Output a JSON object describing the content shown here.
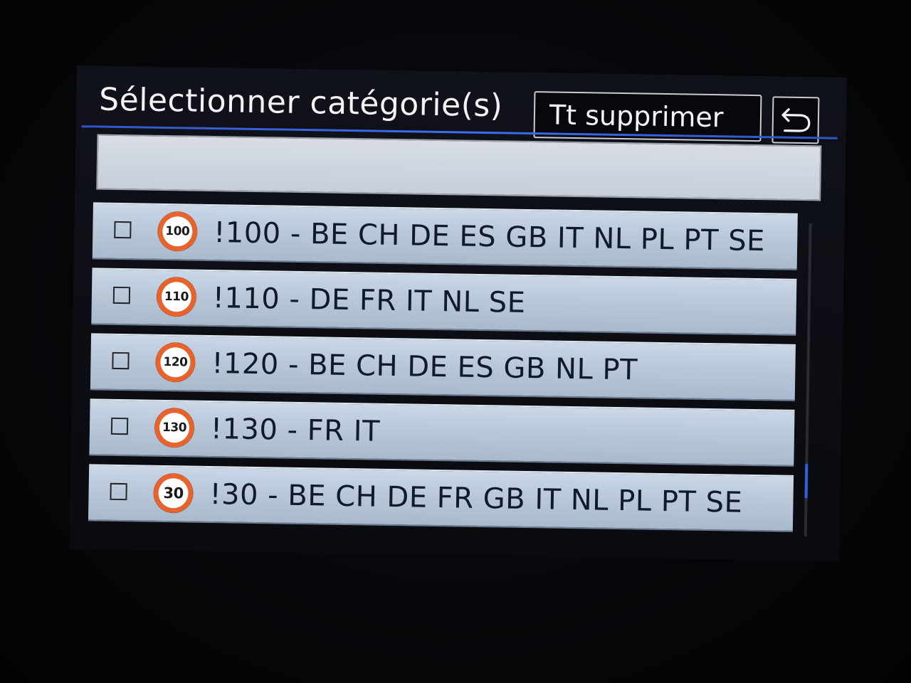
{
  "header": {
    "title": "Sélectionner catégorie(s)",
    "delete_all_label": "Tt supprimer",
    "back_icon": "return-arrow-icon"
  },
  "search": {
    "value": ""
  },
  "list": {
    "items": [
      {
        "sign": "100",
        "label": "!100 - BE CH DE ES GB IT NL PL PT SE",
        "checked": false
      },
      {
        "sign": "110",
        "label": "!110 - DE FR IT NL SE",
        "checked": false
      },
      {
        "sign": "120",
        "label": "!120 - BE CH DE ES GB NL PT",
        "checked": false
      },
      {
        "sign": "130",
        "label": "!130 - FR IT",
        "checked": false
      },
      {
        "sign": "30",
        "label": "!30 - BE CH DE FR GB IT NL PL PT SE",
        "checked": false
      }
    ]
  },
  "colors": {
    "accent_line": "#3d6df0",
    "sign_ring": "#e8622c",
    "row_background": "#b7c7d8"
  }
}
